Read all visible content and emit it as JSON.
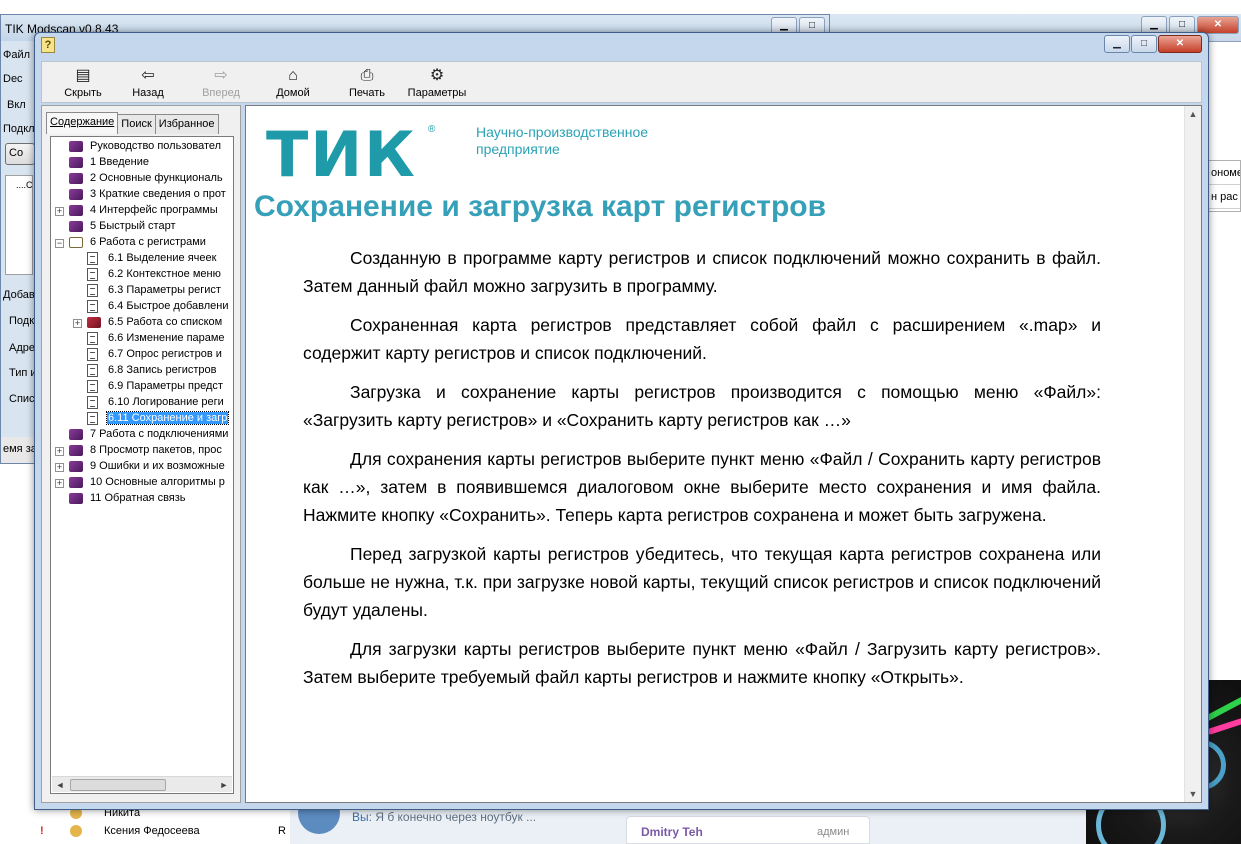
{
  "background_app": {
    "title": "TIK Modscan v0.8.43",
    "side_labels": [
      "Файл",
      "Dec",
      "Вкл",
      "Подкл",
      "Со",
      "Добав",
      "Подк",
      "Адре",
      "Тип и",
      "Спис",
      "емя за"
    ],
    "tree_stub": "....C"
  },
  "background_right": {
    "items": [
      "ономе",
      "н рас"
    ]
  },
  "contacts": {
    "rows": [
      {
        "name": "Никита",
        "rank": ""
      },
      {
        "name": "Ксения Федосеева",
        "rank": "R"
      }
    ]
  },
  "chat": {
    "preview_prefix": "Вы:",
    "preview_text": "Я б конечно через ноутбук ...",
    "card_name": "Dmitry Teh",
    "card_role": "админ"
  },
  "help_window": {
    "icon_label": "?",
    "toolbar": {
      "hide": "Скрыть",
      "back": "Назад",
      "forward": "Вперед",
      "home": "Домой",
      "print": "Печать",
      "options": "Параметры"
    },
    "tabs": [
      "Содержание",
      "Поиск",
      "Избранное"
    ],
    "tree": [
      {
        "label": "Руководство пользовател",
        "level": 0,
        "icon": "book",
        "expander": ""
      },
      {
        "label": "1 Введение",
        "level": 0,
        "icon": "book",
        "expander": ""
      },
      {
        "label": "2 Основные функциональ",
        "level": 0,
        "icon": "book",
        "expander": ""
      },
      {
        "label": "3 Краткие сведения о прот",
        "level": 0,
        "icon": "book",
        "expander": ""
      },
      {
        "label": "4 Интерфейс программы",
        "level": 0,
        "icon": "book",
        "expander": "+"
      },
      {
        "label": "5 Быстрый старт",
        "level": 0,
        "icon": "book",
        "expander": ""
      },
      {
        "label": "6 Работа с регистрами",
        "level": 0,
        "icon": "open-book",
        "expander": "−"
      },
      {
        "label": "6.1 Выделение ячеек",
        "level": 1,
        "icon": "page",
        "expander": ""
      },
      {
        "label": "6.2 Контекстное меню",
        "level": 1,
        "icon": "page",
        "expander": ""
      },
      {
        "label": "6.3 Параметры регист",
        "level": 1,
        "icon": "page",
        "expander": ""
      },
      {
        "label": "6.4 Быстрое добавлени",
        "level": 1,
        "icon": "page",
        "expander": ""
      },
      {
        "label": "6.5 Работа со списком",
        "level": 1,
        "icon": "red-book",
        "expander": "+"
      },
      {
        "label": "6.6 Изменение параме",
        "level": 1,
        "icon": "page",
        "expander": ""
      },
      {
        "label": "6.7 Опрос регистров и",
        "level": 1,
        "icon": "page",
        "expander": ""
      },
      {
        "label": "6.8 Запись регистров",
        "level": 1,
        "icon": "page",
        "expander": ""
      },
      {
        "label": "6.9 Параметры предст",
        "level": 1,
        "icon": "page",
        "expander": ""
      },
      {
        "label": "6.10 Логирование реги",
        "level": 1,
        "icon": "page",
        "expander": ""
      },
      {
        "label": "6.11 Сохранение и загр",
        "level": 1,
        "icon": "page",
        "expander": "",
        "selected": true
      },
      {
        "label": "7 Работа с подключениями",
        "level": 0,
        "icon": "book",
        "expander": ""
      },
      {
        "label": "8 Просмотр пакетов, прос",
        "level": 0,
        "icon": "book",
        "expander": "+"
      },
      {
        "label": "9 Ошибки и их возможные",
        "level": 0,
        "icon": "book",
        "expander": "+"
      },
      {
        "label": "10 Основные алгоритмы р",
        "level": 0,
        "icon": "book",
        "expander": "+"
      },
      {
        "label": "11 Обратная связь",
        "level": 0,
        "icon": "book",
        "expander": ""
      }
    ],
    "content": {
      "logo_mark": "ТИК",
      "logo_reg": "®",
      "logo_text": "Научно-производственное предприятие",
      "title": "Сохранение и загрузка карт регистров",
      "paragraphs": [
        "Созданную в программе карту регистров и список подключений можно сохранить в файл. Затем данный файл можно загрузить в программу.",
        "Сохраненная карта регистров представляет собой файл с расширением «.map» и содержит карту регистров и список подключений.",
        "Загрузка и сохранение карты регистров производится с помощью меню «Файл»: «Загрузить карту регистров» и «Сохранить карту регистров как …»",
        "Для сохранения карты регистров выберите пункт меню «Файл / Сохранить карту регистров как …», затем в появившемся диалоговом окне выберите место сохранения и имя файла. Нажмите кнопку «Сохранить». Теперь карта регистров сохранена и может быть загружена.",
        "Перед загрузкой карты регистров убедитесь, что текущая карта регистров сохранена или больше не нужна, т.к. при загрузке новой карты, текущий список регистров и список подключений будут удалены.",
        "Для загрузки карты регистров выберите пункт меню «Файл / Загрузить карту регистров». Затем выберите требуемый файл карты регистров и нажмите кнопку «Открыть»."
      ]
    }
  },
  "colors": {
    "title_teal": "#36a0b8",
    "logo_teal": "#1e9aa8",
    "selection": "#3399ff"
  }
}
